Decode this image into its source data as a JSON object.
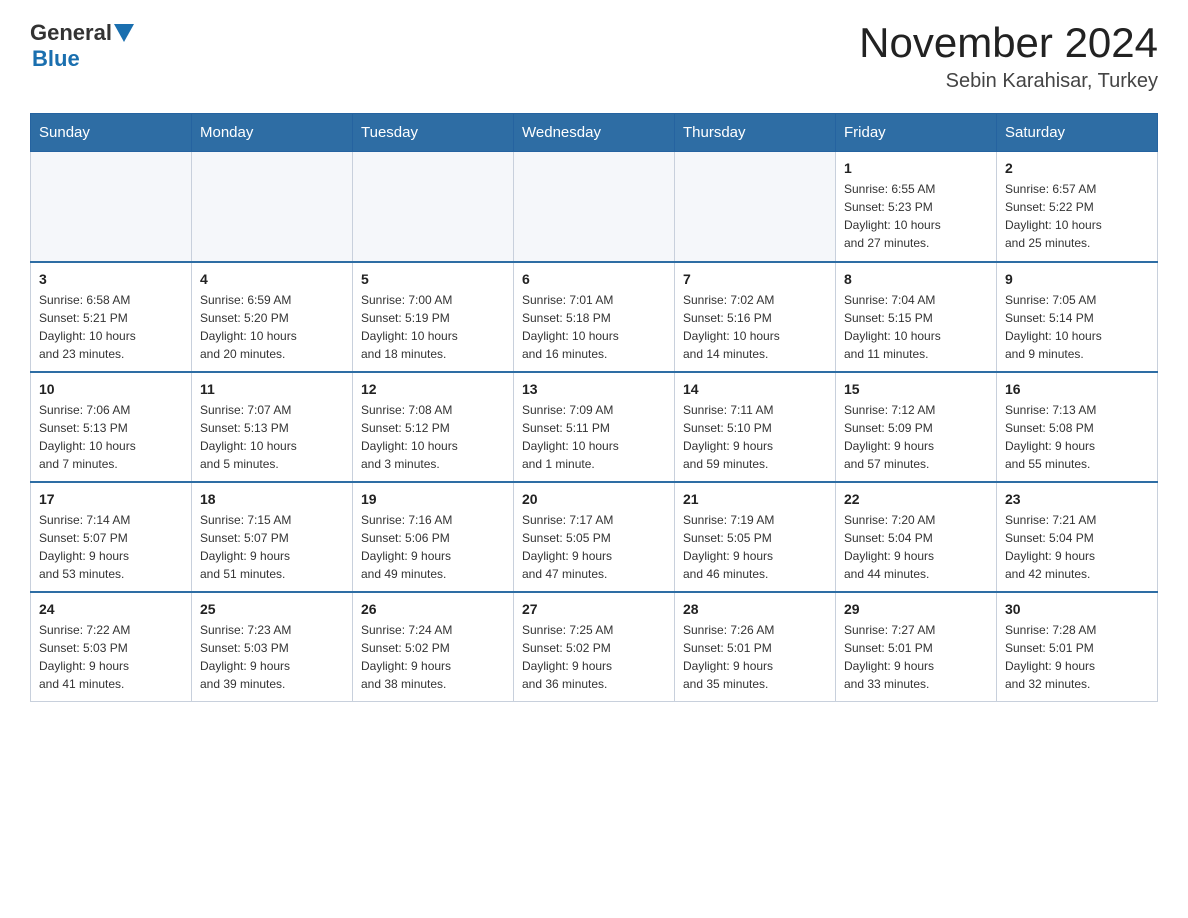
{
  "header": {
    "logo": {
      "general": "General",
      "triangle": "▶",
      "blue": "Blue"
    },
    "title": "November 2024",
    "subtitle": "Sebin Karahisar, Turkey"
  },
  "weekdays": [
    "Sunday",
    "Monday",
    "Tuesday",
    "Wednesday",
    "Thursday",
    "Friday",
    "Saturday"
  ],
  "weeks": [
    [
      {
        "day": "",
        "info": ""
      },
      {
        "day": "",
        "info": ""
      },
      {
        "day": "",
        "info": ""
      },
      {
        "day": "",
        "info": ""
      },
      {
        "day": "",
        "info": ""
      },
      {
        "day": "1",
        "info": "Sunrise: 6:55 AM\nSunset: 5:23 PM\nDaylight: 10 hours\nand 27 minutes."
      },
      {
        "day": "2",
        "info": "Sunrise: 6:57 AM\nSunset: 5:22 PM\nDaylight: 10 hours\nand 25 minutes."
      }
    ],
    [
      {
        "day": "3",
        "info": "Sunrise: 6:58 AM\nSunset: 5:21 PM\nDaylight: 10 hours\nand 23 minutes."
      },
      {
        "day": "4",
        "info": "Sunrise: 6:59 AM\nSunset: 5:20 PM\nDaylight: 10 hours\nand 20 minutes."
      },
      {
        "day": "5",
        "info": "Sunrise: 7:00 AM\nSunset: 5:19 PM\nDaylight: 10 hours\nand 18 minutes."
      },
      {
        "day": "6",
        "info": "Sunrise: 7:01 AM\nSunset: 5:18 PM\nDaylight: 10 hours\nand 16 minutes."
      },
      {
        "day": "7",
        "info": "Sunrise: 7:02 AM\nSunset: 5:16 PM\nDaylight: 10 hours\nand 14 minutes."
      },
      {
        "day": "8",
        "info": "Sunrise: 7:04 AM\nSunset: 5:15 PM\nDaylight: 10 hours\nand 11 minutes."
      },
      {
        "day": "9",
        "info": "Sunrise: 7:05 AM\nSunset: 5:14 PM\nDaylight: 10 hours\nand 9 minutes."
      }
    ],
    [
      {
        "day": "10",
        "info": "Sunrise: 7:06 AM\nSunset: 5:13 PM\nDaylight: 10 hours\nand 7 minutes."
      },
      {
        "day": "11",
        "info": "Sunrise: 7:07 AM\nSunset: 5:13 PM\nDaylight: 10 hours\nand 5 minutes."
      },
      {
        "day": "12",
        "info": "Sunrise: 7:08 AM\nSunset: 5:12 PM\nDaylight: 10 hours\nand 3 minutes."
      },
      {
        "day": "13",
        "info": "Sunrise: 7:09 AM\nSunset: 5:11 PM\nDaylight: 10 hours\nand 1 minute."
      },
      {
        "day": "14",
        "info": "Sunrise: 7:11 AM\nSunset: 5:10 PM\nDaylight: 9 hours\nand 59 minutes."
      },
      {
        "day": "15",
        "info": "Sunrise: 7:12 AM\nSunset: 5:09 PM\nDaylight: 9 hours\nand 57 minutes."
      },
      {
        "day": "16",
        "info": "Sunrise: 7:13 AM\nSunset: 5:08 PM\nDaylight: 9 hours\nand 55 minutes."
      }
    ],
    [
      {
        "day": "17",
        "info": "Sunrise: 7:14 AM\nSunset: 5:07 PM\nDaylight: 9 hours\nand 53 minutes."
      },
      {
        "day": "18",
        "info": "Sunrise: 7:15 AM\nSunset: 5:07 PM\nDaylight: 9 hours\nand 51 minutes."
      },
      {
        "day": "19",
        "info": "Sunrise: 7:16 AM\nSunset: 5:06 PM\nDaylight: 9 hours\nand 49 minutes."
      },
      {
        "day": "20",
        "info": "Sunrise: 7:17 AM\nSunset: 5:05 PM\nDaylight: 9 hours\nand 47 minutes."
      },
      {
        "day": "21",
        "info": "Sunrise: 7:19 AM\nSunset: 5:05 PM\nDaylight: 9 hours\nand 46 minutes."
      },
      {
        "day": "22",
        "info": "Sunrise: 7:20 AM\nSunset: 5:04 PM\nDaylight: 9 hours\nand 44 minutes."
      },
      {
        "day": "23",
        "info": "Sunrise: 7:21 AM\nSunset: 5:04 PM\nDaylight: 9 hours\nand 42 minutes."
      }
    ],
    [
      {
        "day": "24",
        "info": "Sunrise: 7:22 AM\nSunset: 5:03 PM\nDaylight: 9 hours\nand 41 minutes."
      },
      {
        "day": "25",
        "info": "Sunrise: 7:23 AM\nSunset: 5:03 PM\nDaylight: 9 hours\nand 39 minutes."
      },
      {
        "day": "26",
        "info": "Sunrise: 7:24 AM\nSunset: 5:02 PM\nDaylight: 9 hours\nand 38 minutes."
      },
      {
        "day": "27",
        "info": "Sunrise: 7:25 AM\nSunset: 5:02 PM\nDaylight: 9 hours\nand 36 minutes."
      },
      {
        "day": "28",
        "info": "Sunrise: 7:26 AM\nSunset: 5:01 PM\nDaylight: 9 hours\nand 35 minutes."
      },
      {
        "day": "29",
        "info": "Sunrise: 7:27 AM\nSunset: 5:01 PM\nDaylight: 9 hours\nand 33 minutes."
      },
      {
        "day": "30",
        "info": "Sunrise: 7:28 AM\nSunset: 5:01 PM\nDaylight: 9 hours\nand 32 minutes."
      }
    ]
  ]
}
